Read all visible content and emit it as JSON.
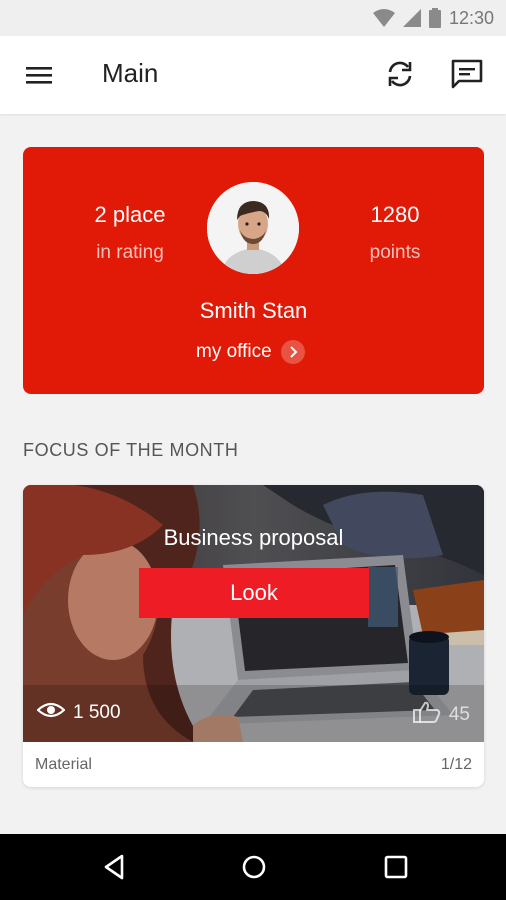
{
  "status_bar": {
    "time": "12:30",
    "icons": [
      "wifi-icon",
      "signal-icon",
      "battery-icon"
    ]
  },
  "app_bar": {
    "title": "Main",
    "icons": [
      "menu-icon",
      "refresh-icon",
      "chat-icon"
    ]
  },
  "profile": {
    "rank_value": "2 place",
    "rank_label": "in rating",
    "points_value": "1280",
    "points_label": "points",
    "name": "Smith Stan",
    "office_link": "my office"
  },
  "focus": {
    "section_title": "FOCUS OF THE MONTH",
    "card_title": "Business proposal",
    "button_label": "Look",
    "views": "1 500",
    "likes": "45",
    "type_label": "Material",
    "pager": "1/12"
  },
  "nav_bar": {
    "icons": [
      "back-icon",
      "home-icon",
      "recents-icon"
    ]
  },
  "colors": {
    "accent": "#e01a06",
    "button": "#ee1c25",
    "background": "#f2f2f2"
  }
}
